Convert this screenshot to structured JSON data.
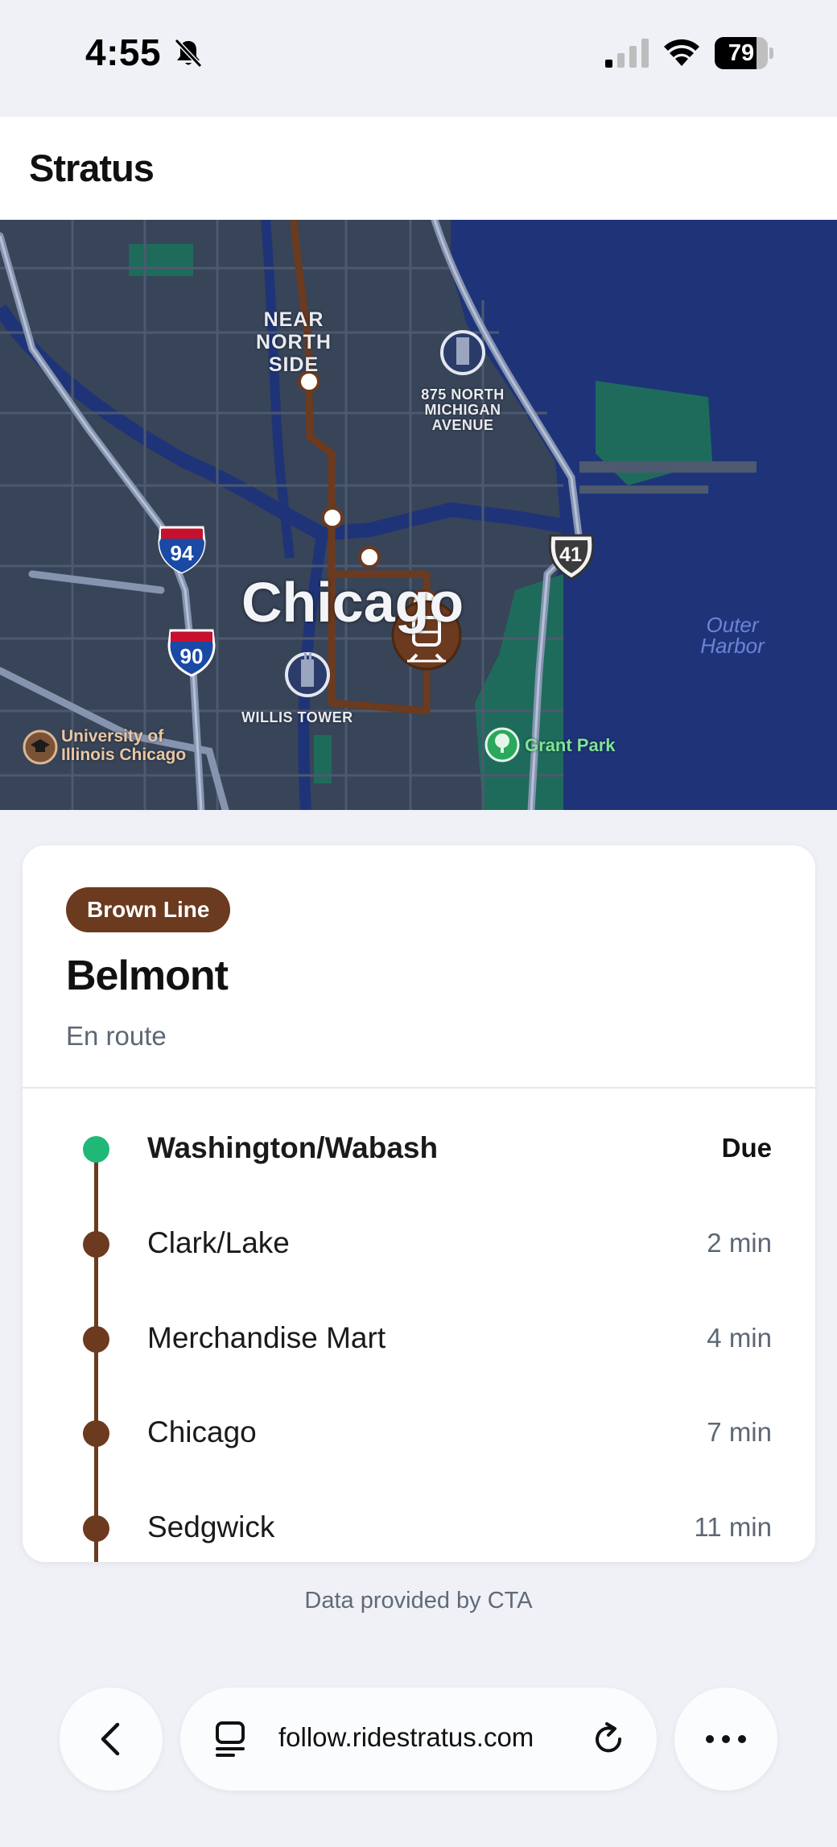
{
  "status_bar": {
    "time": "4:55",
    "battery": "79",
    "battery_level": 0.79,
    "icons": [
      "bell-slash-icon",
      "cellular-signal-icon",
      "wifi-icon",
      "battery-icon"
    ]
  },
  "app": {
    "title": "Stratus"
  },
  "map": {
    "labels": {
      "near_north_side": "NEAR NORTH SIDE",
      "near_north_line1": "NEAR NORTH",
      "near_north_line2": "SIDE",
      "michigan_line1": "875 NORTH",
      "michigan_line2": "MICHIGAN",
      "michigan_line3": "AVENUE",
      "city": "Chicago",
      "willis_tower": "WILLIS TOWER",
      "uic_line1": "University of",
      "uic_line2": "Illinois Chicago",
      "grant_park": "Grant Park",
      "outer_line1": "Outer",
      "outer_line2": "Harbor"
    },
    "shields": {
      "i94": "94",
      "i90": "90",
      "us41": "41"
    },
    "colors": {
      "water": "#1f3478",
      "land": "#384458",
      "park": "#1e6b5c",
      "route": "#6b3a1f"
    },
    "icons": [
      "train-icon",
      "building-icon",
      "tower-icon",
      "university-icon",
      "park-tree-icon"
    ]
  },
  "card": {
    "line_badge": "Brown Line",
    "line_color": "#6b3a1f",
    "destination": "Belmont",
    "status": "En route",
    "stops": [
      {
        "name": "Washington/Wabash",
        "eta": "Due",
        "current": true
      },
      {
        "name": "Clark/Lake",
        "eta": "2 min",
        "current": false
      },
      {
        "name": "Merchandise Mart",
        "eta": "4 min",
        "current": false
      },
      {
        "name": "Chicago",
        "eta": "7 min",
        "current": false
      },
      {
        "name": "Sedgwick",
        "eta": "11 min",
        "current": false
      }
    ]
  },
  "attribution": "Data provided by CTA",
  "browser": {
    "url": "follow.ridestratus.com",
    "icons": [
      "back-chevron-icon",
      "tabs-icon",
      "reload-icon",
      "more-icon"
    ]
  }
}
